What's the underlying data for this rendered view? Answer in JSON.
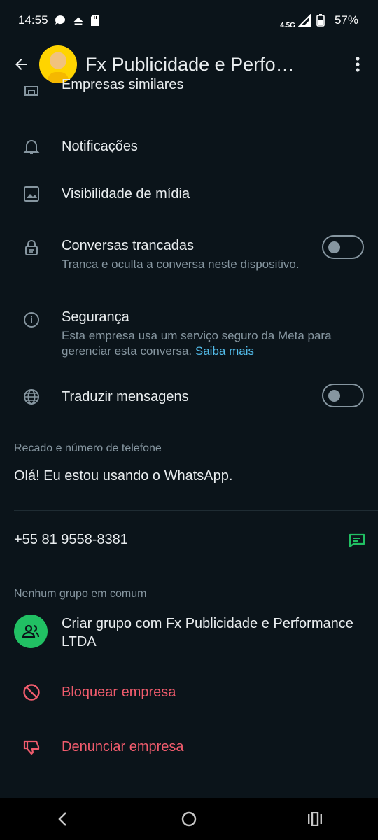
{
  "status_bar": {
    "time": "14:55",
    "network": "4.5G",
    "battery": "57%"
  },
  "header": {
    "title": "Fx Publicidade e Perfor…"
  },
  "menu": {
    "similar_companies": "Empresas similares",
    "notifications": "Notificações",
    "media_visibility": "Visibilidade de mídia",
    "locked_chats": {
      "label": "Conversas trancadas",
      "desc": "Tranca e oculta a conversa neste dispositivo."
    },
    "security": {
      "label": "Segurança",
      "desc": "Esta empresa usa um serviço seguro da Meta para gerenciar esta conversa.",
      "link": "Saiba mais"
    },
    "translate": "Traduzir mensagens"
  },
  "about": {
    "section_title": "Recado e número de telefone",
    "status": "Olá! Eu estou usando o WhatsApp.",
    "phone": "+55 81 9558-8381"
  },
  "groups": {
    "section_title": "Nenhum grupo em comum",
    "create": "Criar grupo com Fx Publicidade e Performance LTDA"
  },
  "actions": {
    "block": "Bloquear empresa",
    "report": "Denunciar empresa"
  },
  "colors": {
    "background": "#0b141a",
    "accent_green": "#21c063",
    "danger": "#f15c6d",
    "link": "#53bdeb"
  }
}
